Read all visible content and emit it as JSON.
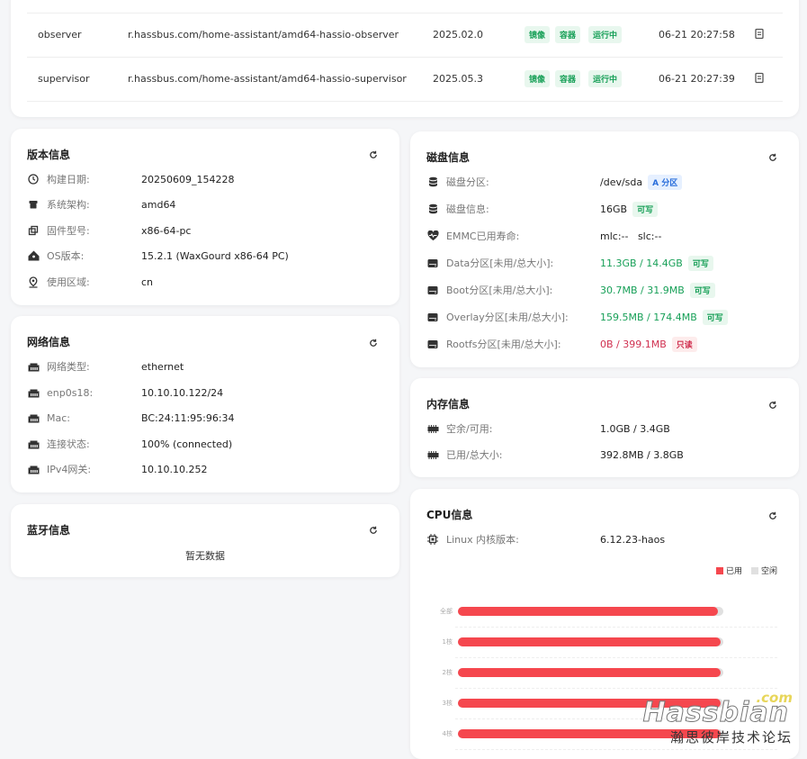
{
  "top_table": {
    "rows": [
      {
        "name": "observer",
        "image": "r.hassbus.com/home-assistant/amd64-hassio-observer",
        "version": "2025.02.0",
        "tags": [
          "镜像",
          "容器",
          "运行中"
        ],
        "time": "06-21 20:27:58"
      },
      {
        "name": "supervisor",
        "image": "r.hassbus.com/home-assistant/amd64-hassio-supervisor",
        "version": "2025.05.3",
        "tags": [
          "镜像",
          "容器",
          "运行中"
        ],
        "time": "06-21 20:27:39"
      }
    ]
  },
  "version_info": {
    "title": "版本信息",
    "rows": [
      {
        "label": "构建日期:",
        "value": "20250609_154228",
        "icon": "clock-icon"
      },
      {
        "label": "系统架构:",
        "value": "amd64",
        "icon": "box-icon"
      },
      {
        "label": "固件型号:",
        "value": "x86-64-pc",
        "icon": "layers-icon"
      },
      {
        "label": "OS版本:",
        "value": "15.2.1 (WaxGourd x86-64 PC)",
        "icon": "home-assistant-icon"
      },
      {
        "label": "使用区域:",
        "value": "cn",
        "icon": "location-icon"
      }
    ]
  },
  "network_info": {
    "title": "网络信息",
    "rows": [
      {
        "label": "网络类型:",
        "value": "ethernet"
      },
      {
        "label": "enp0s18:",
        "value": "10.10.10.122/24"
      },
      {
        "label": "Mac:",
        "value": "BC:24:11:95:96:34"
      },
      {
        "label": "连接状态:",
        "value": "100% (connected)"
      },
      {
        "label": "IPv4网关:",
        "value": "10.10.10.252"
      }
    ]
  },
  "bluetooth_info": {
    "title": "蓝牙信息",
    "empty": "暂无数据"
  },
  "disk_info": {
    "title": "磁盘信息",
    "rows": [
      {
        "label": "磁盘分区:",
        "value": "/dev/sda",
        "tag": "A 分区",
        "tag_type": "blue",
        "value_color": "normal",
        "icon": "database-icon"
      },
      {
        "label": "磁盘信息:",
        "value": "16GB",
        "tag": "可写",
        "tag_type": "green",
        "value_color": "normal",
        "icon": "database-icon"
      },
      {
        "label": "EMMC已用寿命:",
        "value": "mlc:--   slc:--",
        "tag": "",
        "tag_type": "",
        "value_color": "normal",
        "icon": "heart-pulse-icon"
      },
      {
        "label": "Data分区[未用/总大小]:",
        "value": "11.3GB / 14.4GB",
        "tag": "可写",
        "tag_type": "green",
        "value_color": "green",
        "icon": "drive-icon"
      },
      {
        "label": "Boot分区[未用/总大小]:",
        "value": "30.7MB / 31.9MB",
        "tag": "可写",
        "tag_type": "green",
        "value_color": "green",
        "icon": "drive-icon"
      },
      {
        "label": "Overlay分区[未用/总大小]:",
        "value": "159.5MB / 174.4MB",
        "tag": "可写",
        "tag_type": "green",
        "value_color": "green",
        "icon": "drive-icon"
      },
      {
        "label": "Rootfs分区[未用/总大小]:",
        "value": "0B / 399.1MB",
        "tag": "只读",
        "tag_type": "red",
        "value_color": "red",
        "icon": "drive-icon"
      }
    ]
  },
  "memory_info": {
    "title": "内存信息",
    "rows": [
      {
        "label": "空余/可用:",
        "value": "1.0GB / 3.4GB"
      },
      {
        "label": "已用/总大小:",
        "value": "392.8MB / 3.8GB"
      }
    ]
  },
  "cpu_info": {
    "title": "CPU信息",
    "kernel_label": "Linux 内核版本:",
    "kernel_value": "6.12.23-haos",
    "legend_used": "已用",
    "legend_idle": "空闲",
    "color_used": "#f5474e",
    "color_idle": "#e0e0e0"
  },
  "chart_data": {
    "type": "bar",
    "categories": [
      "全部",
      "1核",
      "2核",
      "3核",
      "4核"
    ],
    "series": [
      {
        "name": "已用",
        "values": [
          98,
          99,
          99,
          99,
          99
        ]
      },
      {
        "name": "空闲",
        "values": [
          2,
          1,
          1,
          1,
          1
        ]
      }
    ],
    "orientation": "horizontal",
    "stacked": true,
    "xlim": [
      0,
      100
    ],
    "legend": "top-right"
  },
  "watermark": {
    "brand": "Hassbian",
    "suffix": ".com",
    "subtitle": "瀚思彼岸技术论坛"
  }
}
